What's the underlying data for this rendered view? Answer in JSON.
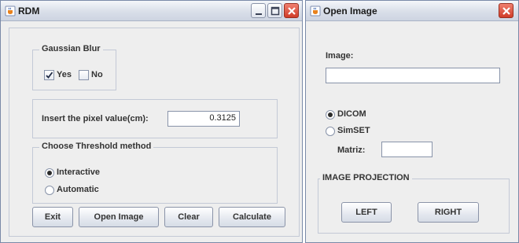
{
  "rdm_window": {
    "title": "RDM",
    "gaussian_blur": {
      "title": "Gaussian Blur",
      "yes_label": "Yes",
      "yes_checked": true,
      "no_label": "No",
      "no_checked": false
    },
    "pixel_value": {
      "label": "Insert the pixel value(cm):",
      "value": "0.3125"
    },
    "threshold": {
      "title": "Choose Threshold method",
      "options": [
        {
          "label": "Interactive",
          "selected": true
        },
        {
          "label": "Automatic",
          "selected": false
        }
      ]
    },
    "buttons": {
      "exit": "Exit",
      "open_image": "Open Image",
      "clear": "Clear",
      "calculate": "Calculate"
    }
  },
  "open_image_window": {
    "title": "Open Image",
    "image_label": "Image:",
    "image_value": "",
    "format": {
      "options": [
        {
          "label": "DICOM",
          "selected": true
        },
        {
          "label": "SimSET",
          "selected": false
        }
      ]
    },
    "matrix_label": "Matriz:",
    "matrix_value": "",
    "projection": {
      "title": "IMAGE PROJECTION",
      "left_label": "LEFT",
      "right_label": "RIGHT"
    }
  },
  "colors": {
    "window_bg": "#eeeeee",
    "close_button": "#d03c28",
    "border": "#c3c9d6"
  },
  "icons": {
    "app": "java-cup-icon",
    "minimize": "minimize-icon",
    "maximize": "maximize-icon",
    "close": "close-icon",
    "check": "check-icon"
  }
}
